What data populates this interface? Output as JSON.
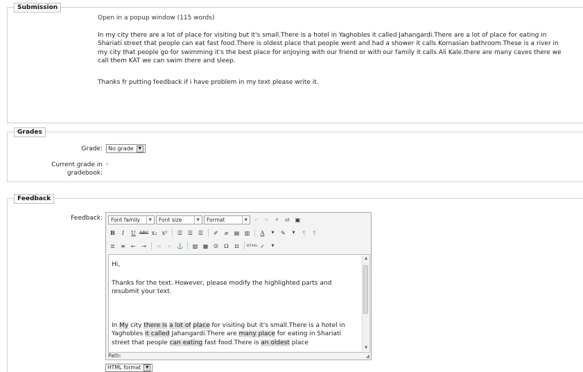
{
  "submission": {
    "legend": "Submission",
    "popup_link": "Open in a popup window",
    "word_count": "(115 words)",
    "paragraph1": "In my city there are a lot of  place for visiting but it's small.There is a hotel in Yaghobles it called Jahangardi.There are a lot of place for eating in Shariati street that people can eat fast food.There is oldest place that people went and had a shower it calls Kornasian bathroom.These is a river in my city that people go for swimming it's the best place for enjoying with our friend or with our family it calls Ali Kale.there are many caves there we call them KAT we can swim there and sleep.",
    "paragraph2": "Thanks fr putting feedback if i have problem in my text please write it."
  },
  "grades": {
    "legend": "Grades",
    "grade_label": "Grade:",
    "grade_value": "No grade",
    "current_label_1": "Current grade in",
    "current_label_2": "gradebook:",
    "current_value": "-"
  },
  "feedback": {
    "legend": "Feedback",
    "label": "Feedback:",
    "toolbar": {
      "font_family": "Font family",
      "font_size": "Font size",
      "format": "Format"
    },
    "editor": {
      "p1": "Hi,",
      "p2": "Thanks for the text. However, please modify the highlighted parts and resubmit your text.",
      "p3_segments": [
        {
          "text": "In ",
          "hl": false
        },
        {
          "text": "My",
          "hl": true
        },
        {
          "text": " city ",
          "hl": false
        },
        {
          "text": "there is",
          "hl": true
        },
        {
          "text": "  ",
          "hl": false
        },
        {
          "text": "a lot of",
          "hl": true
        },
        {
          "text": "  ",
          "hl": false
        },
        {
          "text": "place",
          "hl": true
        },
        {
          "text": " for visiting but it's small.There is a hotel in Yaghobles ",
          "hl": false
        },
        {
          "text": "it called",
          "hl": true
        },
        {
          "text": " Jahangardi.There are ",
          "hl": false
        },
        {
          "text": "many place",
          "hl": true
        },
        {
          "text": " for eating in Shariati street that people ",
          "hl": false
        },
        {
          "text": "can eating",
          "hl": true
        },
        {
          "text": " fast food.There is ",
          "hl": false
        },
        {
          "text": "an oldest",
          "hl": true
        },
        {
          "text": " place",
          "hl": false
        }
      ]
    },
    "path_label": "Path:",
    "format_value": "HTML format"
  },
  "colors": {
    "highlight": "#e1e1e1",
    "border": "#cfcfcf"
  }
}
